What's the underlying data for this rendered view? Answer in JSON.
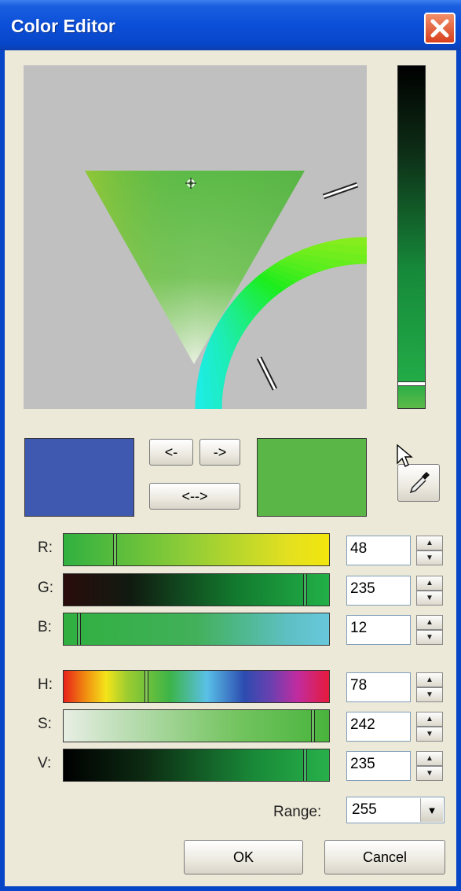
{
  "window": {
    "title": "Color Editor"
  },
  "swatches": {
    "old_color": "#3f59b1",
    "new_color": "#5ab646"
  },
  "buttons": {
    "left": "<-",
    "right": "->",
    "swap": "<-->",
    "ok": "OK",
    "cancel": "Cancel"
  },
  "icons": {
    "close": "close-icon",
    "eyedropper": "eyedropper-icon",
    "cursor": "mouse-cursor-icon"
  },
  "channels": [
    {
      "label": "R:",
      "value": "48",
      "fraction": 0.19
    },
    {
      "label": "G:",
      "value": "235",
      "fraction": 0.92
    },
    {
      "label": "B:",
      "value": "12",
      "fraction": 0.05
    },
    {
      "label": "H:",
      "value": "78",
      "fraction": 0.31
    },
    {
      "label": "S:",
      "value": "242",
      "fraction": 0.95
    },
    {
      "label": "V:",
      "value": "235",
      "fraction": 0.92
    }
  ],
  "range": {
    "label": "Range:",
    "value": "255"
  }
}
